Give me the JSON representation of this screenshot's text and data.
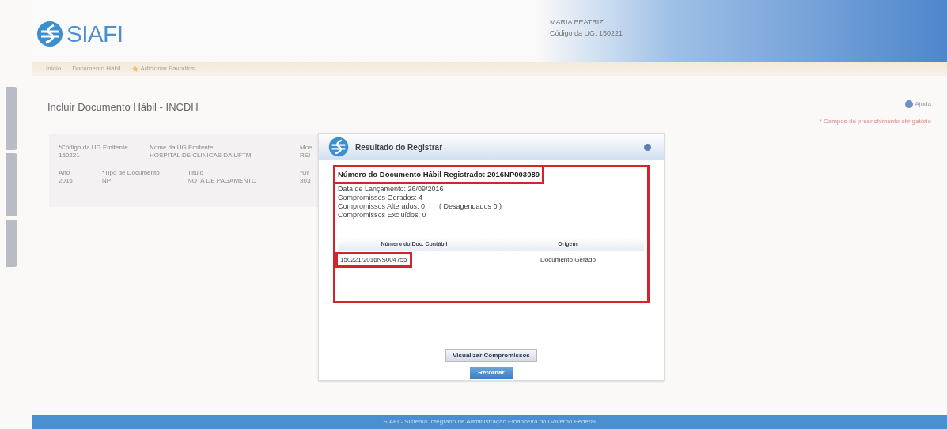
{
  "header": {
    "logo": "SIAFI",
    "user_name": "MARIA BEATRIZ",
    "user_ug": "Código da UG: 150221"
  },
  "breadcrumb": [
    {
      "label": "Início",
      "icon": false
    },
    {
      "label": "Documento Hábil",
      "icon": false
    },
    {
      "label": "Adicionar Favoritos",
      "icon": true
    }
  ],
  "page": {
    "title": "Incluir Documento Hábil - INCDH",
    "help": "Ajuda",
    "required_note": "* Campos de preenchimento obrigatório"
  },
  "form_rows": [
    [
      {
        "label": "*Código da UG Emitente",
        "value": "150221"
      },
      {
        "label": "Nome da UG Emitente",
        "value": "HOSPITAL DE CLINICAS DA UFTM"
      },
      {
        "label": "Moe",
        "value": "REI"
      }
    ],
    [
      {
        "label": "Ano",
        "value": "2016"
      },
      {
        "label": "*Tipo de Documento",
        "value": "NP"
      },
      {
        "label": "Título",
        "value": "NOTA DE PAGAMENTO"
      },
      {
        "label": "*Ur",
        "value": "303"
      }
    ]
  ],
  "dialog": {
    "title": "Resultado do Registrar",
    "document_number": "Número do Documento Hábil Registrado: 2016NP003089",
    "details": [
      {
        "text": "Data de Lançamento:  26/09/2016"
      },
      {
        "text": "Compromissos Gerados:  4"
      },
      {
        "text": "Compromissos Alterados:  0",
        "note": "( Desagendados 0 )"
      },
      {
        "text": "Compromissos Excluídos:  0"
      }
    ],
    "table": {
      "columns": [
        "Número do Doc. Contábil",
        "Origem"
      ],
      "rows": [
        [
          "150221/2016NS004755",
          "Documento Gerado"
        ]
      ]
    },
    "buttons": [
      {
        "label": "Visualizar Compromissos",
        "kind": "secondary"
      },
      {
        "label": "Retornar",
        "kind": "primary"
      }
    ]
  },
  "footer": "SIAFI - Sistema Integrado de Administração Financeira do Governo Federal"
}
